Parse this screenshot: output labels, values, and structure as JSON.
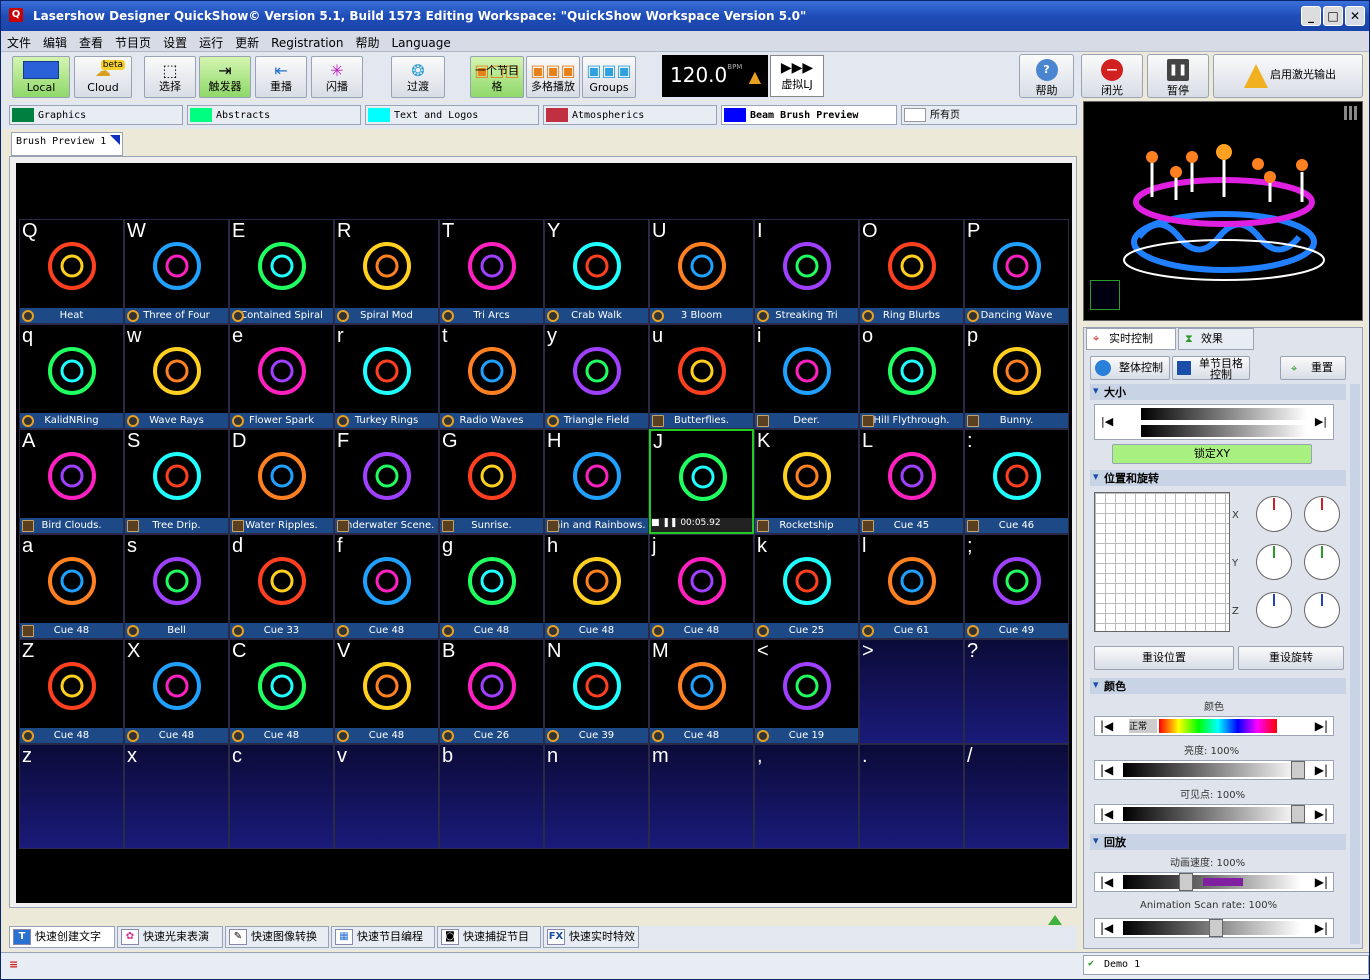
{
  "title": "Lasershow Designer QuickShow©   Version 5.1, Build 1573   Editing Workspace: \"QuickShow Workspace Version 5.0\"",
  "menu": [
    "文件",
    "编辑",
    "查看",
    "节目页",
    "设置",
    "运行",
    "更新",
    "Registration",
    "帮助",
    "Language"
  ],
  "toolbar": {
    "local": "Local",
    "cloud": "Cloud",
    "cloud_badge": "beta",
    "select": "选择",
    "trigger": "触发器",
    "overlay": "重播",
    "flash": "闪播",
    "transition": "过渡",
    "one_cue": "一个节目格",
    "multi_cue": "多格播放",
    "groups": "Groups",
    "bpm": "120.0",
    "bpm_unit": "BPM",
    "virtual_lj": "虚拟LJ",
    "help": "帮助",
    "blackout": "闭光",
    "pause": "暂停",
    "enable_laser": "启用激光输出"
  },
  "page_tabs": [
    {
      "label": "Graphics",
      "color": "#008040"
    },
    {
      "label": "Abstracts",
      "color": "#00ff80"
    },
    {
      "label": "Text and Logos",
      "color": "#00ffff"
    },
    {
      "label": "Atmospherics",
      "color": "#c03040"
    },
    {
      "label": "Beam Brush Preview",
      "color": "#0000ff"
    },
    {
      "label": "所有页",
      "color": "#ffffff"
    }
  ],
  "sub_tab": "Brush Preview 1",
  "cells": [
    {
      "key": "Q",
      "label": "Heat",
      "type": "c"
    },
    {
      "key": "W",
      "label": "Three of Four",
      "type": "c"
    },
    {
      "key": "E",
      "label": "Contained Spiral",
      "type": "c"
    },
    {
      "key": "R",
      "label": "Spiral Mod",
      "type": "c"
    },
    {
      "key": "T",
      "label": "Tri Arcs",
      "type": "c"
    },
    {
      "key": "Y",
      "label": "Crab Walk",
      "type": "c"
    },
    {
      "key": "U",
      "label": "3 Bloom",
      "type": "c"
    },
    {
      "key": "I",
      "label": "Streaking Tri",
      "type": "c"
    },
    {
      "key": "O",
      "label": "Ring Blurbs",
      "type": "c"
    },
    {
      "key": "P",
      "label": "Dancing Wave",
      "type": "c"
    },
    {
      "key": "q",
      "label": "KalidNRing",
      "type": "c"
    },
    {
      "key": "w",
      "label": "Wave Rays",
      "type": "c"
    },
    {
      "key": "e",
      "label": "Flower Spark",
      "type": "c"
    },
    {
      "key": "r",
      "label": "Turkey Rings",
      "type": "c"
    },
    {
      "key": "t",
      "label": "Radio Waves",
      "type": "c"
    },
    {
      "key": "y",
      "label": "Triangle Field",
      "type": "c"
    },
    {
      "key": "u",
      "label": "Butterflies.",
      "type": "f"
    },
    {
      "key": "i",
      "label": "Deer.",
      "type": "f"
    },
    {
      "key": "o",
      "label": "Hill Flythrough.",
      "type": "f"
    },
    {
      "key": "p",
      "label": "Bunny.",
      "type": "f"
    },
    {
      "key": "A",
      "label": "Bird Clouds.",
      "type": "f"
    },
    {
      "key": "S",
      "label": "Tree Drip.",
      "type": "f"
    },
    {
      "key": "D",
      "label": "Water Ripples.",
      "type": "f"
    },
    {
      "key": "F",
      "label": "Underwater Scene.",
      "type": "f"
    },
    {
      "key": "G",
      "label": "Sunrise.",
      "type": "f"
    },
    {
      "key": "H",
      "label": "Rain and Rainbows.",
      "type": "f"
    },
    {
      "key": "J",
      "label": "00:05.92",
      "type": "sel"
    },
    {
      "key": "K",
      "label": "Rocketship",
      "type": "f"
    },
    {
      "key": "L",
      "label": "Cue 45",
      "type": "f"
    },
    {
      "key": ":",
      "label": "Cue 46",
      "type": "f"
    },
    {
      "key": "a",
      "label": "Cue 48",
      "type": "f"
    },
    {
      "key": "s",
      "label": "Bell",
      "type": "c"
    },
    {
      "key": "d",
      "label": "Cue 33",
      "type": "c"
    },
    {
      "key": "f",
      "label": "Cue 48",
      "type": "c"
    },
    {
      "key": "g",
      "label": "Cue 48",
      "type": "c"
    },
    {
      "key": "h",
      "label": "Cue 48",
      "type": "c"
    },
    {
      "key": "j",
      "label": "Cue 48",
      "type": "c"
    },
    {
      "key": "k",
      "label": "Cue 25",
      "type": "c"
    },
    {
      "key": "l",
      "label": "Cue 61",
      "type": "c"
    },
    {
      "key": ";",
      "label": "Cue 49",
      "type": "x"
    },
    {
      "key": "Z",
      "label": "Cue 48",
      "type": "c"
    },
    {
      "key": "X",
      "label": "Cue 48",
      "type": "c"
    },
    {
      "key": "C",
      "label": "Cue 48",
      "type": "c"
    },
    {
      "key": "V",
      "label": "Cue 48",
      "type": "c"
    },
    {
      "key": "B",
      "label": "Cue 26",
      "type": "c"
    },
    {
      "key": "N",
      "label": "Cue 39",
      "type": "c"
    },
    {
      "key": "M",
      "label": "Cue 48",
      "type": "c"
    },
    {
      "key": "<",
      "label": "Cue 19",
      "type": "c"
    },
    {
      "key": ">",
      "label": "",
      "type": "e"
    },
    {
      "key": "?",
      "label": "",
      "type": "e"
    },
    {
      "key": "z",
      "label": "",
      "type": "e"
    },
    {
      "key": "x",
      "label": "",
      "type": "e"
    },
    {
      "key": "c",
      "label": "",
      "type": "e"
    },
    {
      "key": "v",
      "label": "",
      "type": "e"
    },
    {
      "key": "b",
      "label": "",
      "type": "e"
    },
    {
      "key": "n",
      "label": "",
      "type": "e"
    },
    {
      "key": "m",
      "label": "",
      "type": "e"
    },
    {
      "key": ",",
      "label": "",
      "type": "e"
    },
    {
      "key": ".",
      "label": "",
      "type": "e"
    },
    {
      "key": "/",
      "label": "",
      "type": "e"
    }
  ],
  "bottom_tabs": [
    {
      "icon": "T",
      "label": "快速创建文字"
    },
    {
      "icon": "✿",
      "label": "快速光束表演"
    },
    {
      "icon": "✎",
      "label": "快速图像转换"
    },
    {
      "icon": "▦",
      "label": "快速节目编程"
    },
    {
      "icon": "◙",
      "label": "快速捕捉节目"
    },
    {
      "icon": "FX",
      "label": "快速实时特效"
    }
  ],
  "status": {
    "demo": "Demo 1"
  },
  "right": {
    "tab_live": "实时控制",
    "tab_effects": "效果",
    "btn_global": "整体控制",
    "btn_cue": "单节目格\n控制",
    "btn_reset": "重置",
    "sec_size": "大小",
    "lock_xy": "锁定XY",
    "sec_position": "位置和旋转",
    "axis_x": "X",
    "axis_y": "Y",
    "axis_z": "Z",
    "reset_pos": "重设位置",
    "reset_rot": "重设旋转",
    "sec_color": "颜色",
    "color_label": "颜色",
    "normal": "正常",
    "brightness": "亮度: 100%",
    "visible_points": "可见点:  100%",
    "sec_playback": "回放",
    "anim_speed": "动画速度:  100%",
    "scan_rate": "Animation Scan rate: 100%"
  }
}
